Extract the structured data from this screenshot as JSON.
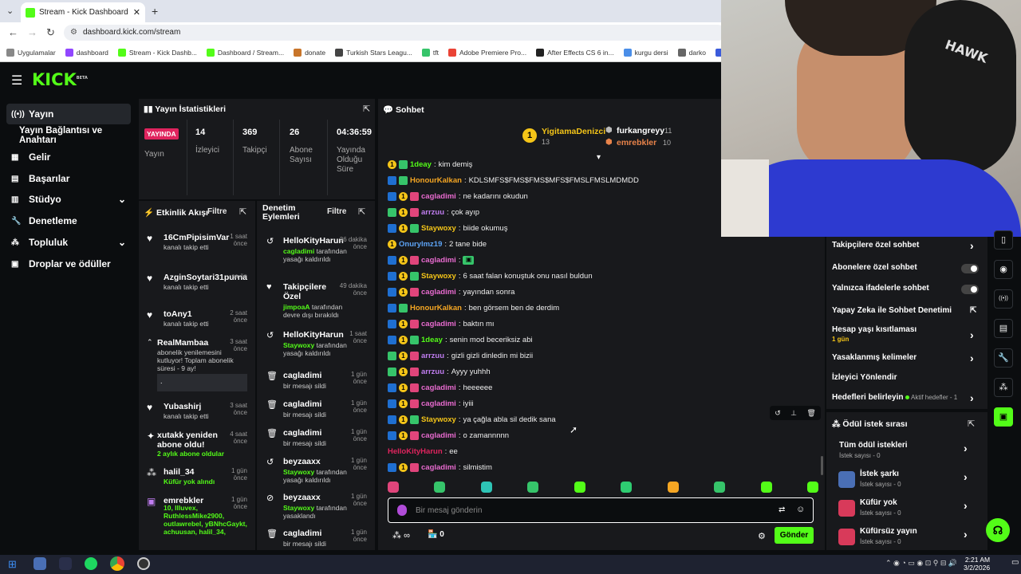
{
  "browser": {
    "tab_title": "Stream - Kick Dashboard",
    "url": "dashboard.kick.com/stream",
    "bookmarks": [
      "Uygulamalar",
      "dashboard",
      "Stream - Kick Dashb...",
      "Dashboard / Stream...",
      "donate",
      "Turkish Stars Leagu...",
      "tft",
      "Adobe Premiere Pro...",
      "After Effects CS 6 in...",
      "kurgu dersi",
      "darko",
      "co"
    ]
  },
  "header": {
    "logo": "KICK",
    "beta": "BETA"
  },
  "sidebar": {
    "items": [
      {
        "label": "Yayın",
        "icon": "broadcast-icon"
      },
      {
        "label": "Yayın Bağlantısı ve Anahtarı",
        "icon": ""
      },
      {
        "label": "Gelir",
        "icon": "revenue-icon"
      },
      {
        "label": "Başarılar",
        "icon": "achievements-icon"
      },
      {
        "label": "Stüdyo",
        "icon": "studio-icon"
      },
      {
        "label": "Denetleme",
        "icon": "wrench-icon"
      },
      {
        "label": "Topluluk",
        "icon": "community-icon"
      },
      {
        "label": "Droplar ve ödüller",
        "icon": "drops-icon"
      }
    ]
  },
  "stats": {
    "title": "Yayın İstatistikleri",
    "live_badge": "YAYINDA",
    "live_label": "Yayın",
    "items": [
      {
        "value": "14",
        "label": "İzleyici"
      },
      {
        "value": "369",
        "label": "Takipçi"
      },
      {
        "value": "26",
        "label": "Abone Sayısı"
      },
      {
        "value": "04:36:59",
        "label": "Yayında Olduğu Süre"
      }
    ]
  },
  "activity": {
    "title": "Etkinlik Akışı",
    "filter": "Filtre",
    "items": [
      {
        "name": "16CmPipisimVar",
        "sub": "kanalı takip etti",
        "time": "1 saat önce"
      },
      {
        "name": "AzginSoytari31purna",
        "sub": "kanalı takip etti",
        "time": "sa ön"
      },
      {
        "name": "toAny1",
        "sub": "kanalı takip etti",
        "time": "2 saat önce"
      },
      {
        "name": "RealMambaa",
        "sub": "abonelik yenilemesini kutluyor! Toplam abonelik süresi - 9 ay!",
        "time": "3 saat önce",
        "note": "."
      },
      {
        "name": "Yubashirj",
        "sub": "kanalı takip etti",
        "time": "3 saat önce"
      },
      {
        "name": "xutakk yeniden abone oldu!",
        "sub": "2 aylık abone oldular",
        "time": "4 saat önce"
      },
      {
        "name": "halil_34",
        "sub": "Küfür yok alındı",
        "time": "1 gün önce"
      },
      {
        "name": "emrebkler",
        "sub": "10, Illuvex, RuthlessMike2900, outlawrebel, yBNhcGaykt, achuusan, halil_34,",
        "time": "1 gün önce"
      }
    ]
  },
  "moderation": {
    "title": "Denetim Eylemleri",
    "filter": "Filtre",
    "items": [
      {
        "name": "HelloKityHarun",
        "actor": "cagladimi",
        "sub": "tarafından yasağı kaldırıldı",
        "time": "36 dakika önce"
      },
      {
        "name": "Takipçilere Özel",
        "actor": "jimpoaA",
        "sub": "tarafından devre dışı bırakıldı",
        "time": "49 dakika önce"
      },
      {
        "name": "HelloKityHarun",
        "actor": "Staywoxy",
        "sub": "tarafından yasağı kaldırıldı",
        "time": "1 saat önce"
      },
      {
        "name": "cagladimi",
        "actor": "",
        "sub": "bir mesajı sildi",
        "time": "1 gün önce"
      },
      {
        "name": "cagladimi",
        "actor": "",
        "sub": "bir mesajı sildi",
        "time": "1 gün önce"
      },
      {
        "name": "cagladimi",
        "actor": "",
        "sub": "bir mesajı sildi",
        "time": "1 gün önce"
      },
      {
        "name": "beyzaaxx",
        "actor": "Staywoxy",
        "sub": "tarafından yasağı kaldırıldı",
        "time": "1 gün önce"
      },
      {
        "name": "beyzaaxx",
        "actor": "Staywoxy",
        "sub": "tarafından yasaklandı",
        "time": "1 gün önce"
      },
      {
        "name": "cagladimi",
        "actor": "",
        "sub": "bir mesajı sildi",
        "time": "1 gün önce"
      }
    ]
  },
  "chat": {
    "title": "Sohbet",
    "top": [
      {
        "name": "YigitamaDenizci",
        "count": "13"
      },
      {
        "name": "furkangreyy",
        "count": "11"
      },
      {
        "name": "emrebkler",
        "count": "10"
      }
    ],
    "messages": [
      {
        "user": "1deay",
        "text": "kim demiş",
        "color": "#53fc18",
        "badges": [
          "gold",
          "green"
        ]
      },
      {
        "user": "HonourKalkan",
        "text": "KDLSMFS$FMS$FMS$MFS$FMSLFMSLMDMDD",
        "color": "#f5a623",
        "badges": [
          "mod",
          "green"
        ]
      },
      {
        "user": "cagladimi",
        "text": "ne kadarını okudun",
        "color": "#e96bd0",
        "badges": [
          "mod",
          "gold",
          "vip"
        ]
      },
      {
        "user": "arrzuu",
        "text": "çok ayıp",
        "color": "#c07df0",
        "badges": [
          "green",
          "gold",
          "vip"
        ]
      },
      {
        "user": "Staywoxy",
        "text": "biide okumuş",
        "color": "#f5c518",
        "badges": [
          "mod",
          "gold",
          "green"
        ]
      },
      {
        "user": "Onurylmz19",
        "text": "2 tane bide",
        "color": "#5ca3f5",
        "badges": [
          "gold"
        ]
      },
      {
        "user": "cagladimi",
        "text": "▣",
        "color": "#e96bd0",
        "badges": [
          "mod",
          "gold",
          "vip"
        ]
      },
      {
        "user": "Staywoxy",
        "text": "6 saat falan konuştuk onu nasıl buldun",
        "color": "#f5c518",
        "badges": [
          "mod",
          "gold",
          "green"
        ]
      },
      {
        "user": "cagladimi",
        "text": "yayından sonra",
        "color": "#e96bd0",
        "badges": [
          "mod",
          "gold",
          "vip"
        ]
      },
      {
        "user": "HonourKalkan",
        "text": "ben görsem ben de derdim",
        "color": "#f5a623",
        "badges": [
          "mod",
          "green"
        ]
      },
      {
        "user": "cagladimi",
        "text": "baktın mı",
        "color": "#e96bd0",
        "badges": [
          "mod",
          "gold",
          "vip"
        ]
      },
      {
        "user": "1deay",
        "text": "senin mod beceriksiz abi",
        "color": "#53fc18",
        "badges": [
          "mod",
          "gold",
          "green"
        ]
      },
      {
        "user": "arrzuu",
        "text": "gizli gizli dinledin mi bizii",
        "color": "#c07df0",
        "badges": [
          "green",
          "gold",
          "vip"
        ]
      },
      {
        "user": "arrzuu",
        "text": "Ayyy yuhhh",
        "color": "#c07df0",
        "badges": [
          "green",
          "gold",
          "vip"
        ]
      },
      {
        "user": "cagladimi",
        "text": "heeeeee",
        "color": "#e96bd0",
        "badges": [
          "mod",
          "gold",
          "vip"
        ]
      },
      {
        "user": "cagladimi",
        "text": "iyiii",
        "color": "#e96bd0",
        "badges": [
          "mod",
          "gold",
          "vip"
        ]
      },
      {
        "user": "Staywoxy",
        "text": "ya çağla abla sil dedik sana",
        "color": "#f5c518",
        "badges": [
          "mod",
          "gold",
          "green"
        ]
      },
      {
        "user": "cagladimi",
        "text": "o zamannnnn",
        "color": "#e96bd0",
        "badges": [
          "mod",
          "gold",
          "vip"
        ]
      },
      {
        "user": "HelloKityHarun",
        "text": "ee",
        "color": "#e0245e",
        "badges": []
      },
      {
        "user": "cagladimi",
        "text": "silmistim",
        "color": "#e96bd0",
        "badges": [
          "mod",
          "gold",
          "vip"
        ]
      }
    ],
    "input_placeholder": "Bir mesaj gönderin",
    "points": "∞",
    "store_count": "0",
    "send": "Gönder"
  },
  "chat_settings": {
    "items": [
      {
        "label": "Takipçilere özel sohbet",
        "type": "chevron"
      },
      {
        "label": "Abonelere özel sohbet",
        "type": "toggle"
      },
      {
        "label": "Yalnızca ifadelerle sohbet",
        "type": "toggle"
      },
      {
        "label": "Yapay Zeka ile Sohbet Denetimi",
        "type": "external"
      },
      {
        "label": "Hesap yaşı kısıtlaması",
        "sub": "1 gün",
        "type": "chevron"
      },
      {
        "label": "Yasaklanmış kelimeler",
        "type": "chevron"
      },
      {
        "label": "İzleyici Yönlendir",
        "type": "none"
      },
      {
        "label": "Hedefleri belirleyin",
        "sub": "Aktif hedefler - 1",
        "type": "chevron"
      }
    ]
  },
  "rewards": {
    "title": "Ödül istek sırası",
    "items": [
      {
        "label": "Tüm ödül istekleri",
        "sub": "İstek sayısı - 0"
      },
      {
        "label": "İstek şarkı",
        "sub": "İstek sayısı - 0"
      },
      {
        "label": "Küfür yok",
        "sub": "İstek sayısı - 0"
      },
      {
        "label": "Küfürsüz yayın",
        "sub": "İstek sayısı - 0"
      }
    ]
  },
  "taskbar": {
    "time": "2:21 AM",
    "date": "3/2/2026"
  },
  "colors": {
    "accent": "#53fc18",
    "panel": "#18191c",
    "bg": "#0b0d0f",
    "live": "#e0245e"
  }
}
